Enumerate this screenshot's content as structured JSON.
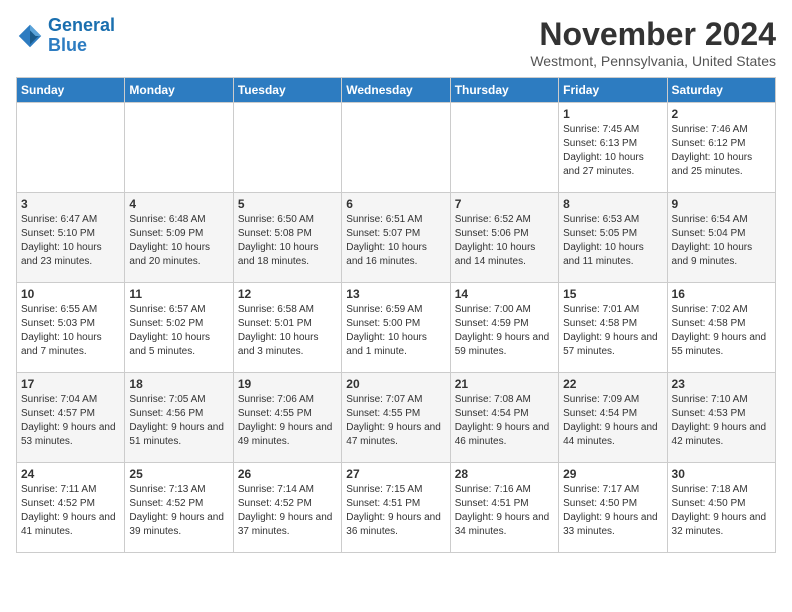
{
  "logo": {
    "text_general": "General",
    "text_blue": "Blue"
  },
  "header": {
    "month": "November 2024",
    "location": "Westmont, Pennsylvania, United States"
  },
  "days_of_week": [
    "Sunday",
    "Monday",
    "Tuesday",
    "Wednesday",
    "Thursday",
    "Friday",
    "Saturday"
  ],
  "weeks": [
    [
      {
        "day": "",
        "content": ""
      },
      {
        "day": "",
        "content": ""
      },
      {
        "day": "",
        "content": ""
      },
      {
        "day": "",
        "content": ""
      },
      {
        "day": "",
        "content": ""
      },
      {
        "day": "1",
        "content": "Sunrise: 7:45 AM\nSunset: 6:13 PM\nDaylight: 10 hours and 27 minutes."
      },
      {
        "day": "2",
        "content": "Sunrise: 7:46 AM\nSunset: 6:12 PM\nDaylight: 10 hours and 25 minutes."
      }
    ],
    [
      {
        "day": "3",
        "content": "Sunrise: 6:47 AM\nSunset: 5:10 PM\nDaylight: 10 hours and 23 minutes."
      },
      {
        "day": "4",
        "content": "Sunrise: 6:48 AM\nSunset: 5:09 PM\nDaylight: 10 hours and 20 minutes."
      },
      {
        "day": "5",
        "content": "Sunrise: 6:50 AM\nSunset: 5:08 PM\nDaylight: 10 hours and 18 minutes."
      },
      {
        "day": "6",
        "content": "Sunrise: 6:51 AM\nSunset: 5:07 PM\nDaylight: 10 hours and 16 minutes."
      },
      {
        "day": "7",
        "content": "Sunrise: 6:52 AM\nSunset: 5:06 PM\nDaylight: 10 hours and 14 minutes."
      },
      {
        "day": "8",
        "content": "Sunrise: 6:53 AM\nSunset: 5:05 PM\nDaylight: 10 hours and 11 minutes."
      },
      {
        "day": "9",
        "content": "Sunrise: 6:54 AM\nSunset: 5:04 PM\nDaylight: 10 hours and 9 minutes."
      }
    ],
    [
      {
        "day": "10",
        "content": "Sunrise: 6:55 AM\nSunset: 5:03 PM\nDaylight: 10 hours and 7 minutes."
      },
      {
        "day": "11",
        "content": "Sunrise: 6:57 AM\nSunset: 5:02 PM\nDaylight: 10 hours and 5 minutes."
      },
      {
        "day": "12",
        "content": "Sunrise: 6:58 AM\nSunset: 5:01 PM\nDaylight: 10 hours and 3 minutes."
      },
      {
        "day": "13",
        "content": "Sunrise: 6:59 AM\nSunset: 5:00 PM\nDaylight: 10 hours and 1 minute."
      },
      {
        "day": "14",
        "content": "Sunrise: 7:00 AM\nSunset: 4:59 PM\nDaylight: 9 hours and 59 minutes."
      },
      {
        "day": "15",
        "content": "Sunrise: 7:01 AM\nSunset: 4:58 PM\nDaylight: 9 hours and 57 minutes."
      },
      {
        "day": "16",
        "content": "Sunrise: 7:02 AM\nSunset: 4:58 PM\nDaylight: 9 hours and 55 minutes."
      }
    ],
    [
      {
        "day": "17",
        "content": "Sunrise: 7:04 AM\nSunset: 4:57 PM\nDaylight: 9 hours and 53 minutes."
      },
      {
        "day": "18",
        "content": "Sunrise: 7:05 AM\nSunset: 4:56 PM\nDaylight: 9 hours and 51 minutes."
      },
      {
        "day": "19",
        "content": "Sunrise: 7:06 AM\nSunset: 4:55 PM\nDaylight: 9 hours and 49 minutes."
      },
      {
        "day": "20",
        "content": "Sunrise: 7:07 AM\nSunset: 4:55 PM\nDaylight: 9 hours and 47 minutes."
      },
      {
        "day": "21",
        "content": "Sunrise: 7:08 AM\nSunset: 4:54 PM\nDaylight: 9 hours and 46 minutes."
      },
      {
        "day": "22",
        "content": "Sunrise: 7:09 AM\nSunset: 4:54 PM\nDaylight: 9 hours and 44 minutes."
      },
      {
        "day": "23",
        "content": "Sunrise: 7:10 AM\nSunset: 4:53 PM\nDaylight: 9 hours and 42 minutes."
      }
    ],
    [
      {
        "day": "24",
        "content": "Sunrise: 7:11 AM\nSunset: 4:52 PM\nDaylight: 9 hours and 41 minutes."
      },
      {
        "day": "25",
        "content": "Sunrise: 7:13 AM\nSunset: 4:52 PM\nDaylight: 9 hours and 39 minutes."
      },
      {
        "day": "26",
        "content": "Sunrise: 7:14 AM\nSunset: 4:52 PM\nDaylight: 9 hours and 37 minutes."
      },
      {
        "day": "27",
        "content": "Sunrise: 7:15 AM\nSunset: 4:51 PM\nDaylight: 9 hours and 36 minutes."
      },
      {
        "day": "28",
        "content": "Sunrise: 7:16 AM\nSunset: 4:51 PM\nDaylight: 9 hours and 34 minutes."
      },
      {
        "day": "29",
        "content": "Sunrise: 7:17 AM\nSunset: 4:50 PM\nDaylight: 9 hours and 33 minutes."
      },
      {
        "day": "30",
        "content": "Sunrise: 7:18 AM\nSunset: 4:50 PM\nDaylight: 9 hours and 32 minutes."
      }
    ]
  ]
}
